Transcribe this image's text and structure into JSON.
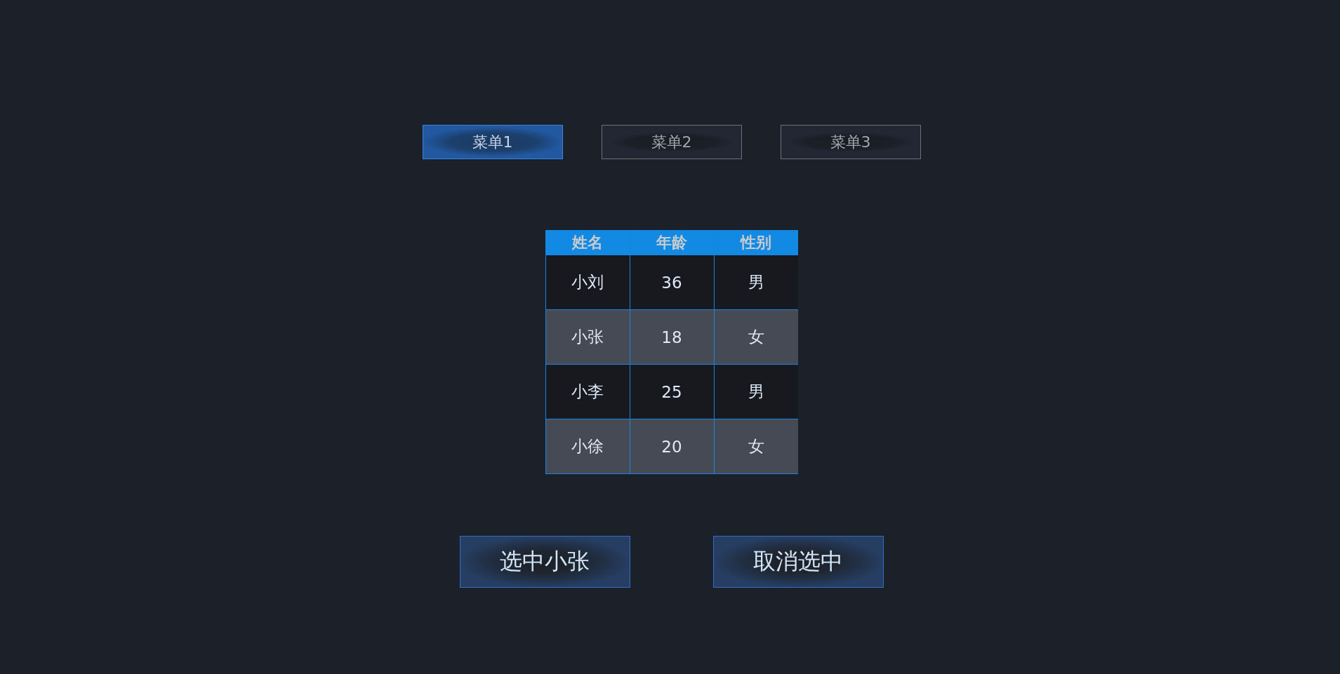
{
  "tabs": [
    {
      "label": "菜单1",
      "selected": true
    },
    {
      "label": "菜单2",
      "selected": false
    },
    {
      "label": "菜单3",
      "selected": false
    }
  ],
  "table": {
    "columns": [
      "姓名",
      "年龄",
      "性别"
    ],
    "rows": [
      [
        "小刘",
        "36",
        "男"
      ],
      [
        "小张",
        "18",
        "女"
      ],
      [
        "小李",
        "25",
        "男"
      ],
      [
        "小徐",
        "20",
        "女"
      ]
    ]
  },
  "buttons": [
    "选中小张",
    "取消选中"
  ]
}
